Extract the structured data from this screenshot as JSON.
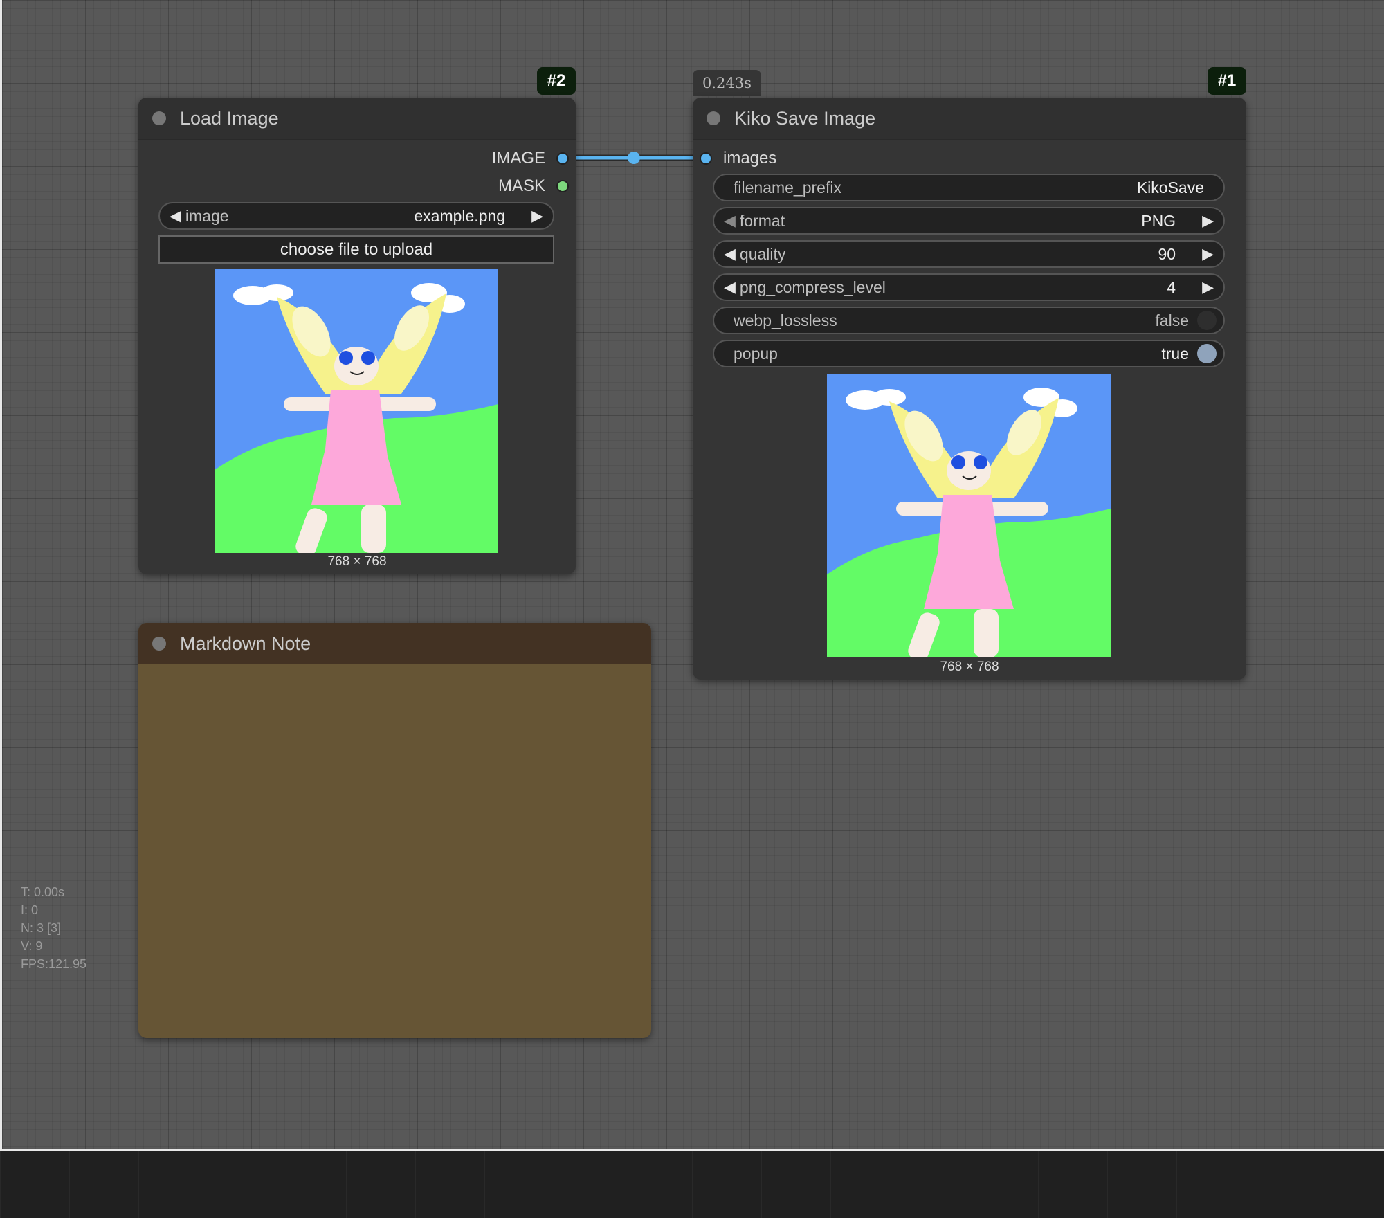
{
  "load_image_node": {
    "id_badge": "#2",
    "title": "Load Image",
    "outputs": [
      {
        "label": "IMAGE",
        "color": "#5ab4f0"
      },
      {
        "label": "MASK",
        "color": "#7dd87d"
      }
    ],
    "image_widget": {
      "label": "image",
      "value": "example.png"
    },
    "upload_button": "choose file to upload",
    "preview_caption": "768 × 768"
  },
  "kiko_save_node": {
    "id_badge": "#1",
    "timing": "0.243s",
    "title": "Kiko Save Image",
    "input": {
      "label": "images",
      "color": "#5ab4f0"
    },
    "widgets": {
      "filename_prefix": {
        "label": "filename_prefix",
        "value": "KikoSave"
      },
      "format": {
        "label": "format",
        "value": "PNG"
      },
      "quality": {
        "label": "quality",
        "value": "90"
      },
      "png_compress_level": {
        "label": "png_compress_level",
        "value": "4"
      },
      "webp_lossless": {
        "label": "webp_lossless",
        "value": "false"
      },
      "popup": {
        "label": "popup",
        "value": "true"
      }
    },
    "preview_caption": "768 × 768"
  },
  "markdown_note_node": {
    "title": "Markdown Note",
    "colors": {
      "title_bg": "#433223",
      "body_bg": "#665535"
    }
  },
  "link_color": "#5ab4f0",
  "stats": {
    "time": "T: 0.00s",
    "iterations": "I: 0",
    "nodes": "N: 3 [3]",
    "visible": "V: 9",
    "fps": "FPS:121.95"
  }
}
